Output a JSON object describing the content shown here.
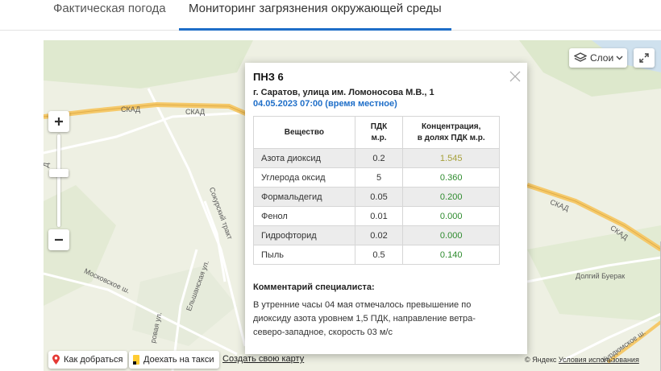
{
  "tabs": [
    {
      "label": "Фактическая погода"
    },
    {
      "label": "Мониторинг загрязнения окружающей среды"
    }
  ],
  "map": {
    "layers_label": "Слои",
    "road_labels": {
      "skad1": "СКАД",
      "skad2": "СКАД",
      "skad3": "СКАД",
      "skad4": "СКАД",
      "sokursky": "Сокурский тракт",
      "moskovskoe": "Московское ш.",
      "elshanskaya": "Ельшанская ул.",
      "kurdyumskoe": "Курдюмское ш.",
      "dolgiy_buerak": "Долгий Буерак",
      "rovaya": "ровая ул.",
      "left_label": "Д"
    },
    "route_label": "Как добраться",
    "taxi_label": "Доехать на такси",
    "create_map_label": "Создать свою карту",
    "copyright": "© Яндекс",
    "terms": "Условия использования"
  },
  "station": {
    "title": "ПНЗ 6",
    "address": "г. Саратов, улица им. Ломоносова М.В., 1",
    "datetime": "04.05.2023 07:00 (время местное)",
    "table": {
      "headers": [
        "Вещество",
        "ПДК м.р.",
        "Концентрация, в долях ПДК м.р."
      ],
      "h_substance": "Вещество",
      "h_pdk_1": "ПДК",
      "h_pdk_2": "м.р.",
      "h_conc_1": "Концентрация,",
      "h_conc_2": "в долях ПДК м.р.",
      "rows": [
        {
          "substance": "Азота диоксид",
          "pdk": "0.2",
          "conc": "1.545",
          "color": "#a6a03a"
        },
        {
          "substance": "Углерода оксид",
          "pdk": "5",
          "conc": "0.360",
          "color": "#2e8b2e"
        },
        {
          "substance": "Формальдегид",
          "pdk": "0.05",
          "conc": "0.200",
          "color": "#2e8b2e"
        },
        {
          "substance": "Фенол",
          "pdk": "0.01",
          "conc": "0.000",
          "color": "#2e8b2e"
        },
        {
          "substance": "Гидрофторид",
          "pdk": "0.02",
          "conc": "0.000",
          "color": "#2e8b2e"
        },
        {
          "substance": "Пыль",
          "pdk": "0.5",
          "conc": "0.140",
          "color": "#2e8b2e"
        }
      ]
    },
    "comment_heading": "Комментарий специалиста:",
    "comment": "В утренние часы 04 мая отмечалось превышение по диоксиду азота уровнем 1,5 ПДК, направление ветра- северо-западное, скорость 03 м/с"
  },
  "colors": {
    "accent": "#1e6ec8",
    "road": "#f5c96a",
    "map_bg": "#eef0e3"
  }
}
